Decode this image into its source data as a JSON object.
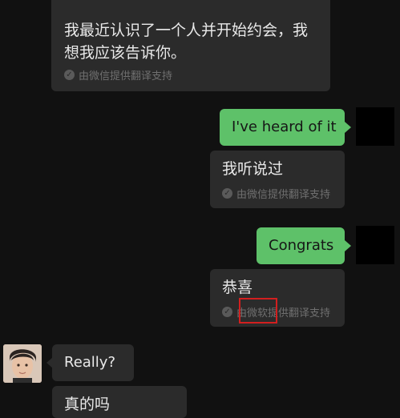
{
  "messages": {
    "m1_translation": "我最近认识了一个人并开始约会，我想我应该告诉你。",
    "m1_translation_line1": "我最近认识了一个人并开始约会，我",
    "m1_translation_line2": "想我应该告诉你。",
    "m1_provider": "由微信提供翻译支持",
    "m2_text": "I've heard of it",
    "m2_translation": "我听说过",
    "m2_provider": "由微信提供翻译支持",
    "m3_text": "Congrats",
    "m3_translation": "恭喜",
    "m3_provider": "由微软提供翻译支持",
    "m4_text": "Really?",
    "m5_translation_partial": "真的吗"
  },
  "colors": {
    "background": "#111111",
    "bubble_dark": "#2b2b2b",
    "bubble_green": "#5ec169",
    "highlight_box": "#d21f1f"
  }
}
